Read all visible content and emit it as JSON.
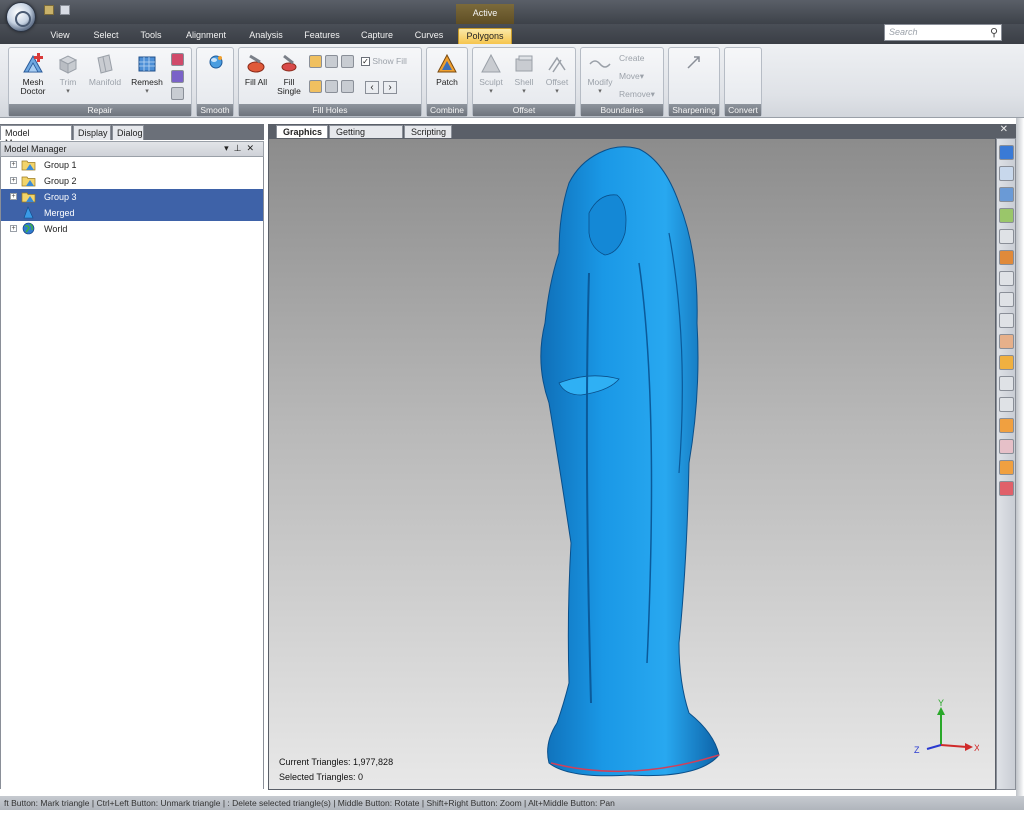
{
  "title_bar": {
    "context_tab_label": "Active"
  },
  "tabs": [
    {
      "label": "View"
    },
    {
      "label": "Select"
    },
    {
      "label": "Tools"
    },
    {
      "label": "Alignment"
    },
    {
      "label": "Analysis"
    },
    {
      "label": "Features"
    },
    {
      "label": "Capture"
    },
    {
      "label": "Curves"
    },
    {
      "label": "Polygons",
      "active": true
    }
  ],
  "search": {
    "placeholder": "Search",
    "icon": "search-icon"
  },
  "ribbon": {
    "repair": {
      "label": "Repair",
      "mesh_doctor": "Mesh Doctor",
      "trim": "Trim",
      "manifold": "Manifold",
      "remesh": "Remesh"
    },
    "smooth": {
      "label": "Smooth"
    },
    "fill_holes": {
      "label": "Fill Holes",
      "fill_all": "Fill All",
      "fill_single": "Fill Single",
      "show_fill": "Show Fill"
    },
    "combine": {
      "label": "Combine",
      "patch": "Patch"
    },
    "offset": {
      "label": "Offset",
      "sculpt": "Sculpt",
      "shell": "Shell",
      "offset": "Offset"
    },
    "boundaries": {
      "label": "Boundaries",
      "modify": "Modify",
      "create": "Create",
      "move": "Move",
      "remove": "Remove"
    },
    "sharpening": {
      "label": "Sharpening"
    },
    "convert": {
      "label": "Convert"
    }
  },
  "left_panel": {
    "tabs": [
      "Model Manager",
      "Display",
      "Dialog"
    ],
    "header": "Model Manager",
    "tree": [
      {
        "label": "Group 1",
        "icon": "folder-icon",
        "selected": false
      },
      {
        "label": "Group 2",
        "icon": "folder-icon",
        "selected": false
      },
      {
        "label": "Group 3",
        "icon": "folder-icon",
        "selected": true
      },
      {
        "label": "Merged",
        "icon": "mesh-icon",
        "selected": true
      },
      {
        "label": "World",
        "icon": "globe-icon",
        "selected": false
      }
    ]
  },
  "graphics": {
    "tabs": [
      "Graphics",
      "Getting Started",
      "Scripting"
    ],
    "current_triangles": "Current Triangles: 1,977,828",
    "selected_triangles": "Selected Triangles: 0",
    "axis": {
      "y": "Y",
      "z": "Z",
      "x": "X"
    },
    "model_color": "#1a98e6"
  },
  "status_bar": "ft Button: Mark triangle | Ctrl+Left Button: Unmark triangle | : Delete selected triangle(s) | Middle Button: Rotate | Shift+Right Button: Zoom | Alt+Middle Button: Pan"
}
